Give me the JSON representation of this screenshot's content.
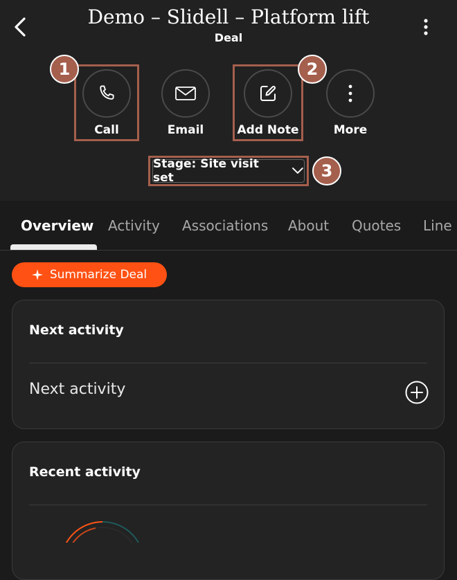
{
  "header": {
    "title": "Demo – Slidell – Platform lift",
    "subtitle": "Deal"
  },
  "actions": [
    {
      "label": "Call",
      "icon": "phone-icon"
    },
    {
      "label": "Email",
      "icon": "mail-icon"
    },
    {
      "label": "Add Note",
      "icon": "note-edit-icon"
    },
    {
      "label": "More",
      "icon": "more-vertical-icon"
    }
  ],
  "stage": {
    "label": "Stage: Site visit set"
  },
  "annotations": {
    "badge1": "1",
    "badge2": "2",
    "badge3": "3"
  },
  "tabs": [
    {
      "label": "Overview",
      "active": true
    },
    {
      "label": "Activity"
    },
    {
      "label": "Associations"
    },
    {
      "label": "About"
    },
    {
      "label": "Quotes"
    },
    {
      "label": "Line"
    }
  ],
  "summarize": {
    "label": "Summarize Deal",
    "icon": "sparkle-icon"
  },
  "cards": {
    "next_activity": {
      "title": "Next activity",
      "row_label": "Next activity"
    },
    "recent_activity": {
      "title": "Recent activity"
    }
  },
  "colors": {
    "accent": "#ff5113",
    "annotation": "#a55f4d",
    "background": "#1b1b1b",
    "header": "#212121"
  }
}
